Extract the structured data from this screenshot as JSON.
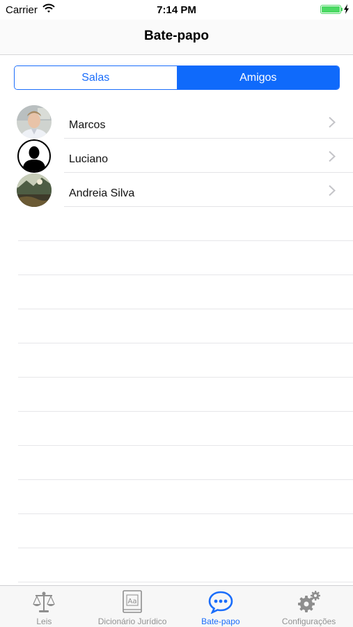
{
  "status_bar": {
    "carrier": "Carrier",
    "time": "7:14 PM"
  },
  "nav": {
    "title": "Bate-papo"
  },
  "segments": {
    "salas": "Salas",
    "amigos": "Amigos",
    "selected": "Amigos"
  },
  "contacts": [
    {
      "name": "Marcos",
      "avatar": "photo-avatar"
    },
    {
      "name": "Luciano",
      "avatar": "default-silhouette-avatar"
    },
    {
      "name": "Andreia Silva",
      "avatar": "landscape-avatar"
    }
  ],
  "tabs": [
    {
      "label": "Leis",
      "icon": "scales-icon",
      "active": false
    },
    {
      "label": "Dicionário Jurídico",
      "icon": "dictionary-icon",
      "active": false
    },
    {
      "label": "Bate-papo",
      "icon": "chat-icon",
      "active": true
    },
    {
      "label": "Configurações",
      "icon": "gears-icon",
      "active": false
    }
  ],
  "colors": {
    "accent": "#1a6dfb",
    "inactive_tab": "#929292",
    "battery": "#4cd964"
  }
}
